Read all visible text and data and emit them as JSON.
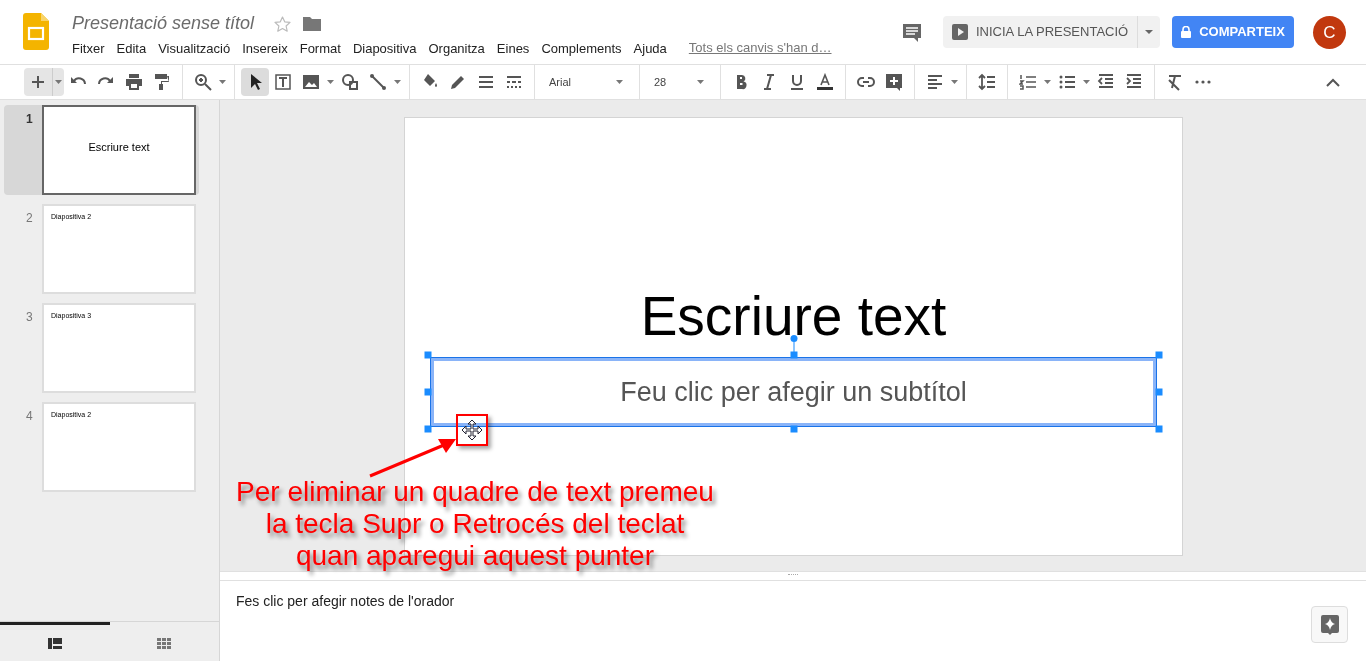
{
  "document": {
    "title": "Presentació sense títol",
    "starred": false,
    "save_status": "Tots els canvis s'han d…"
  },
  "menu": [
    "Fitxer",
    "Edita",
    "Visualització",
    "Insereix",
    "Format",
    "Diapositiva",
    "Organitza",
    "Eines",
    "Complements",
    "Ajuda"
  ],
  "present_button": "INICIA LA PRESENTACIÓ",
  "share_button": "COMPARTEIX",
  "avatar": "C",
  "tools": [
    {
      "selected": true
    },
    {
      "selected": false
    },
    {
      "selected": false
    },
    {
      "selected": false
    },
    {
      "selected": false
    }
  ],
  "font": "Arial",
  "font_size": "28",
  "slides": [
    {
      "number": "1",
      "kind": "title",
      "text": "Escriure text",
      "selected": true
    },
    {
      "number": "2",
      "kind": "heading",
      "text": "Diapositiva 2",
      "selected": false
    },
    {
      "number": "3",
      "kind": "heading",
      "text": "Diapositiva 3",
      "selected": false
    },
    {
      "number": "4",
      "kind": "heading",
      "text": "Diapositiva 2",
      "selected": false
    }
  ],
  "view_tabs": [
    {
      "selected": true
    },
    {
      "selected": false
    }
  ],
  "slide": {
    "title": "Escriure text",
    "subtitle_placeholder": "Feu clic per afegir un subtítol",
    "subtitle_selected": true
  },
  "notes_placeholder": "Fes clic per afegir notes de l'orador",
  "annotation": "Per eliminar un quadre de text premeu la tecla Supr o Retrocés del teclat quan aparegui aquest punter"
}
